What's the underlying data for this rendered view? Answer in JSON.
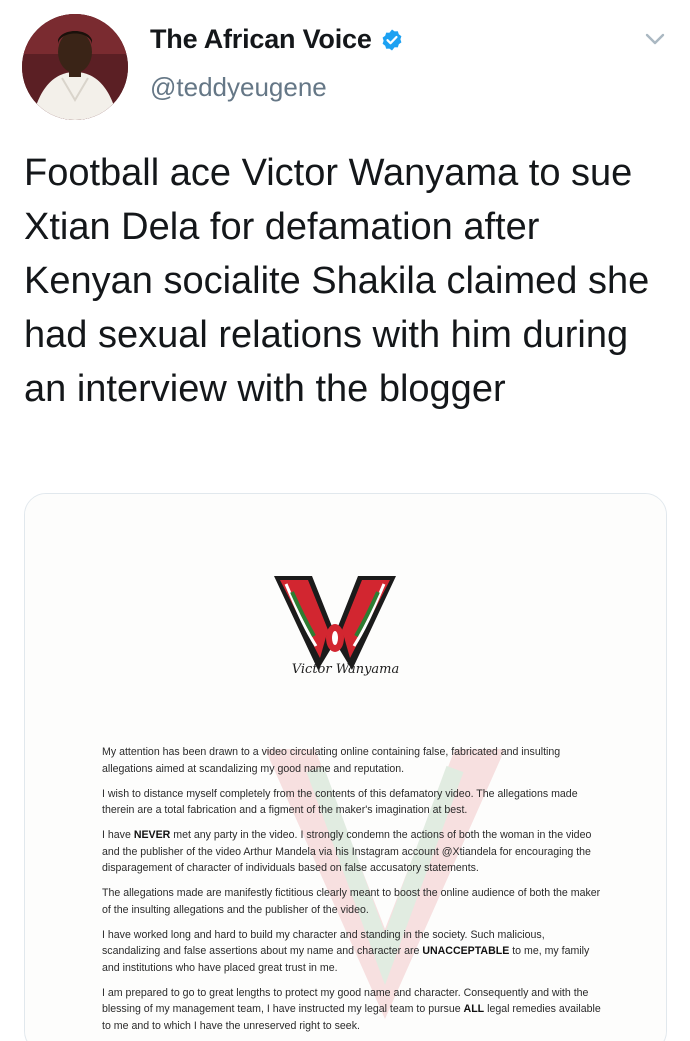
{
  "author": {
    "display_name": "The African Voice",
    "handle": "@teddyeugene",
    "verified": true,
    "avatar": "avatar-photo"
  },
  "icons": {
    "verified": "verified-badge-icon",
    "menu": "chevron-down-icon"
  },
  "tweet": {
    "text": "Football ace Victor Wanyama to sue Xtian Dela for defamation after  Kenyan socialite Shakila claimed she had sexual relations with him during an interview with the blogger"
  },
  "media": {
    "logo_caption": "Victor Wanyama",
    "paragraphs": [
      "My attention has been drawn to a video circulating online containing false, fabricated and insulting allegations aimed at scandalizing my good name and reputation.",
      "I wish to distance myself completely from the contents of this defamatory video. The allegations made therein are a total fabrication and a figment of the maker's imagination at best.",
      "I have NEVER met any party in the video. I strongly condemn the actions of both the woman in the video and the publisher of the video Arthur Mandela via his Instagram account @Xtiandela for encouraging the disparagement of character of individuals based on false accusatory statements.",
      "The allegations made are manifestly fictitious clearly meant to boost the online audience of both the maker of the insulting allegations and the publisher of the video.",
      "I have worked long and hard to build my character and standing in the society. Such malicious, scandalizing and false assertions about my name and character are UNACCEPTABLE to me, my family and institutions who have placed great trust in me.",
      "I am prepared to go to great lengths to protect my good name and character. Consequently and with the blessing of my management team, I have instructed my legal team to pursue ALL legal remedies available to me and to which I have the unreserved right to seek."
    ]
  },
  "colors": {
    "verified_blue": "#1da1f2",
    "logo_red": "#d22630",
    "logo_green": "#2e7d32"
  }
}
